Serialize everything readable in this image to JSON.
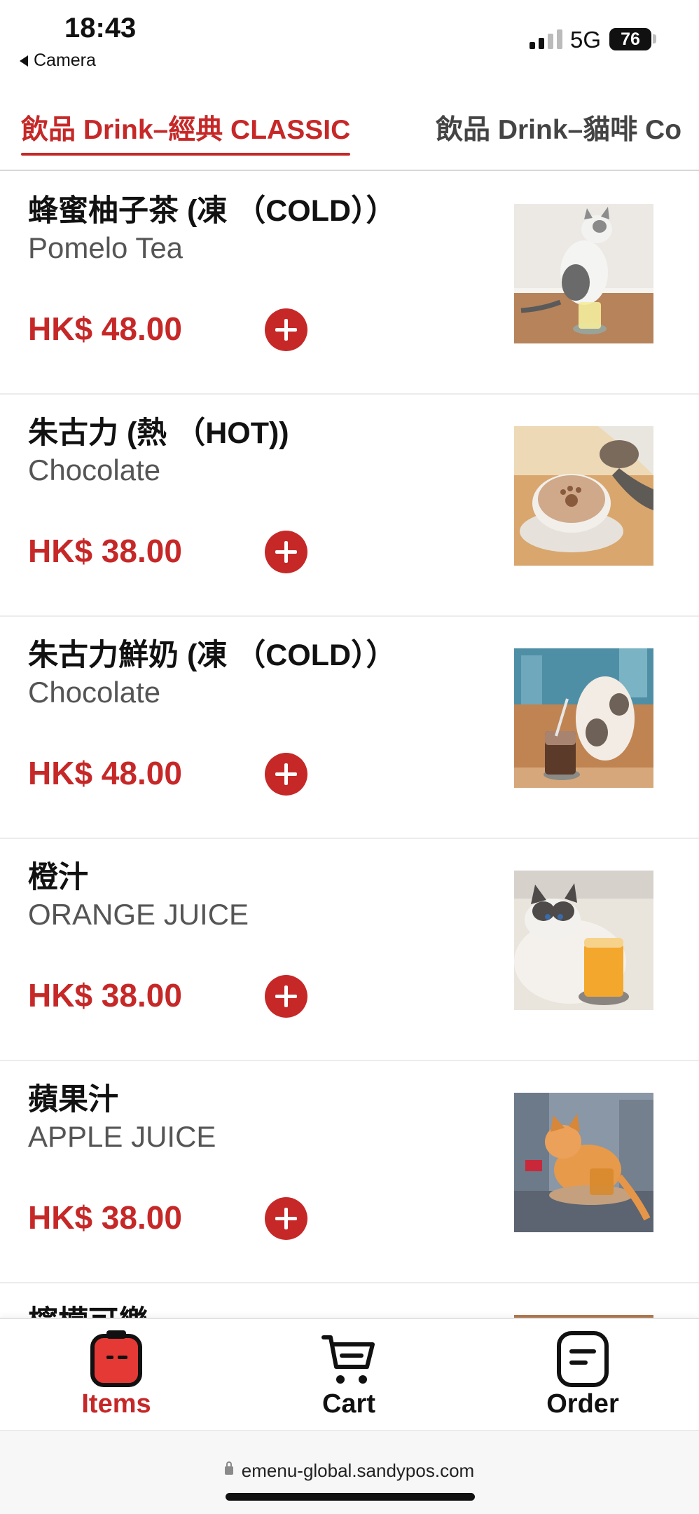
{
  "status_bar": {
    "time": "18:43",
    "back_app": "Camera",
    "network": "5G",
    "battery": "76"
  },
  "tabs": [
    {
      "label": "飲品 Drink–經典 CLASSIC",
      "active": true
    },
    {
      "label": "飲品 Drink–貓啡 Co",
      "active": false
    }
  ],
  "menu": {
    "items": [
      {
        "name": "蜂蜜柚子茶 (凍 （COLD））",
        "subtitle": "Pomelo Tea",
        "price": "HK$ 48.00"
      },
      {
        "name": "朱古力 (熱 （HOT))",
        "subtitle": "Chocolate",
        "price": "HK$ 38.00"
      },
      {
        "name": "朱古力鮮奶 (凍 （COLD））",
        "subtitle": "Chocolate",
        "price": "HK$ 48.00"
      },
      {
        "name": "橙汁",
        "subtitle": "ORANGE JUICE",
        "price": "HK$ 38.00"
      },
      {
        "name": "蘋果汁",
        "subtitle": "APPLE JUICE",
        "price": "HK$ 38.00"
      },
      {
        "name": "檸檬可樂",
        "subtitle": "",
        "price": ""
      }
    ]
  },
  "bottom_nav": {
    "items_label": "Items",
    "cart_label": "Cart",
    "order_label": "Order"
  },
  "address_bar": {
    "url": "emenu-global.sandypos.com"
  },
  "colors": {
    "accent": "#c62828",
    "text": "#111111",
    "subtext": "#555555"
  }
}
